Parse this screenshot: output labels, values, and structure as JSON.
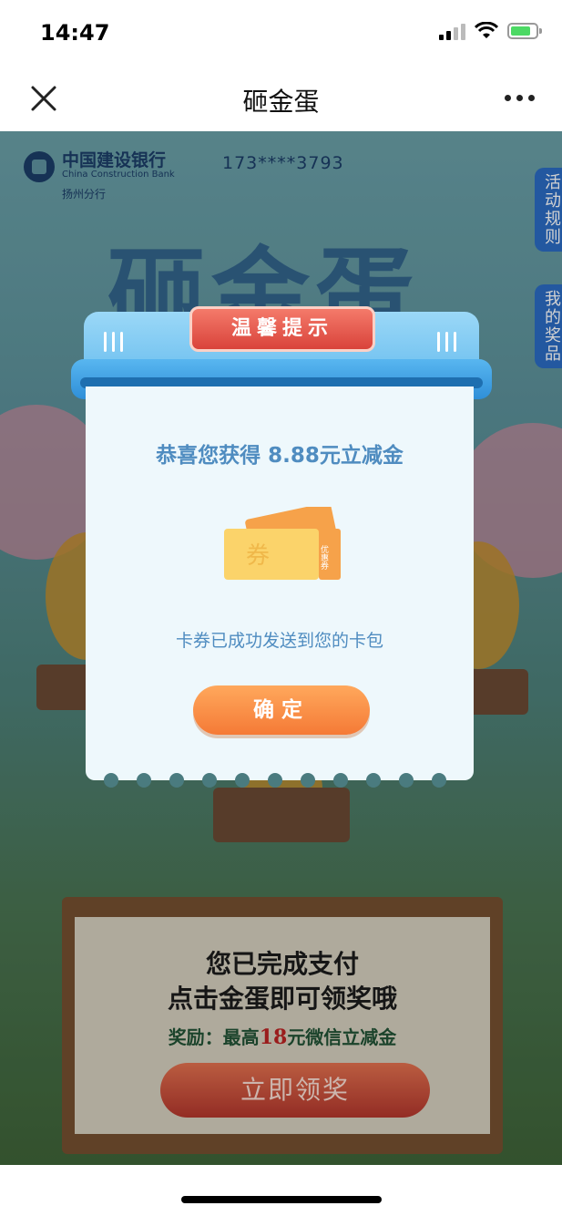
{
  "status_bar": {
    "time": "14:47"
  },
  "nav": {
    "title": "砸金蛋"
  },
  "page": {
    "bank_name": "中国建设银行",
    "bank_name_en": "China Construction Bank",
    "bank_branch": "扬州分行",
    "phone": "173****3793",
    "big_title": "砸金蛋",
    "side_tabs": [
      "活动规则",
      "我的奖品"
    ],
    "board": {
      "line1": "您已完成支付",
      "line2": "点击金蛋即可领奖哦",
      "reward_prefix": "奖励：最高",
      "reward_amount": "18",
      "reward_suffix": "元微信立减金",
      "claim_button": "立即领奖"
    }
  },
  "modal": {
    "tag": "温馨提示",
    "congrats": "恭喜您获得 8.88元立减金",
    "coupon_char": "券",
    "coupon_side_text": "优惠券",
    "delivered": "卡券已成功发送到您的卡包",
    "confirm_button": "确定"
  },
  "colors": {
    "accent_blue": "#4f8cc0",
    "confirm_orange": "#f57a36",
    "tag_red": "#d9433b"
  },
  "icons": [
    "close-icon",
    "more-icon",
    "signal-icon",
    "wifi-icon",
    "battery-icon",
    "bank-logo-icon",
    "coupon-icon"
  ]
}
